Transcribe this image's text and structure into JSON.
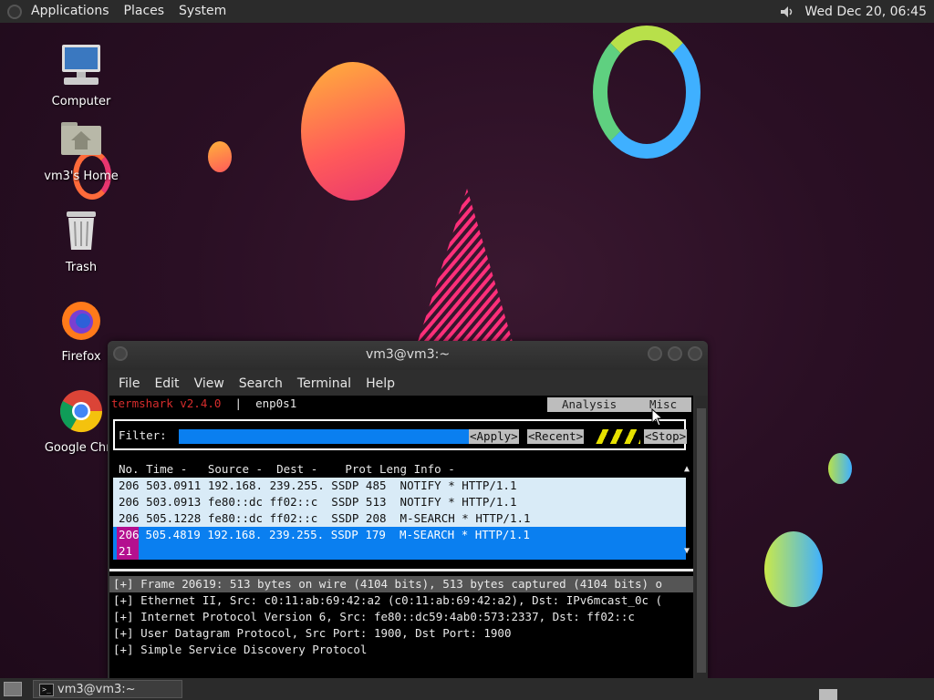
{
  "top_panel": {
    "menus": [
      "Applications",
      "Places",
      "System"
    ],
    "clock": "Wed Dec 20, 06:45"
  },
  "desktop_icons": [
    {
      "label": "Computer",
      "icon": "computer-icon"
    },
    {
      "label": "vm3's Home",
      "icon": "home-folder-icon"
    },
    {
      "label": "Trash",
      "icon": "trash-icon"
    },
    {
      "label": "Firefox",
      "icon": "firefox-icon"
    },
    {
      "label": "Google Chro",
      "icon": "chrome-icon"
    }
  ],
  "window": {
    "title": "vm3@vm3:~",
    "menus": [
      "File",
      "Edit",
      "View",
      "Search",
      "Terminal",
      "Help"
    ]
  },
  "termshark": {
    "app": "termshark v2.4.0",
    "sep": "|",
    "interface": "enp0s1",
    "tabs": [
      "Analysis",
      "Misc"
    ],
    "filter_label": "Filter:",
    "apply": "<Apply>",
    "recent": "<Recent>",
    "stop": "<Stop>",
    "columns": "No. Time -   Source -  Dest -    Prot Leng Info -",
    "packets": [
      "206 503.0911 192.168. 239.255. SSDP 485  NOTIFY * HTTP/1.1",
      "206 503.0913 fe80::dc ff02::c  SSDP 513  NOTIFY * HTTP/1.1",
      "206 505.1228 fe80::dc ff02::c  SSDP 208  M-SEARCH * HTTP/1.1"
    ],
    "selected_num": "206",
    "selected_rest": " 505.4819 192.168. 239.255. SSDP 179  M-SEARCH * HTTP/1.1",
    "selected_num2": "21",
    "details": [
      "[+] Frame 20619: 513 bytes on wire (4104 bits), 513 bytes captured (4104 bits) o",
      "[+] Ethernet II, Src: c0:11:ab:69:42:a2 (c0:11:ab:69:42:a2), Dst: IPv6mcast_0c (",
      "[+] Internet Protocol Version 6, Src: fe80::dc59:4ab0:573:2337, Dst: ff02::c",
      "[+] User Datagram Protocol, Src Port: 1900, Dst Port: 1900",
      "[+] Simple Service Discovery Protocol"
    ]
  },
  "taskbar": {
    "window_label": "vm3@vm3:~"
  }
}
